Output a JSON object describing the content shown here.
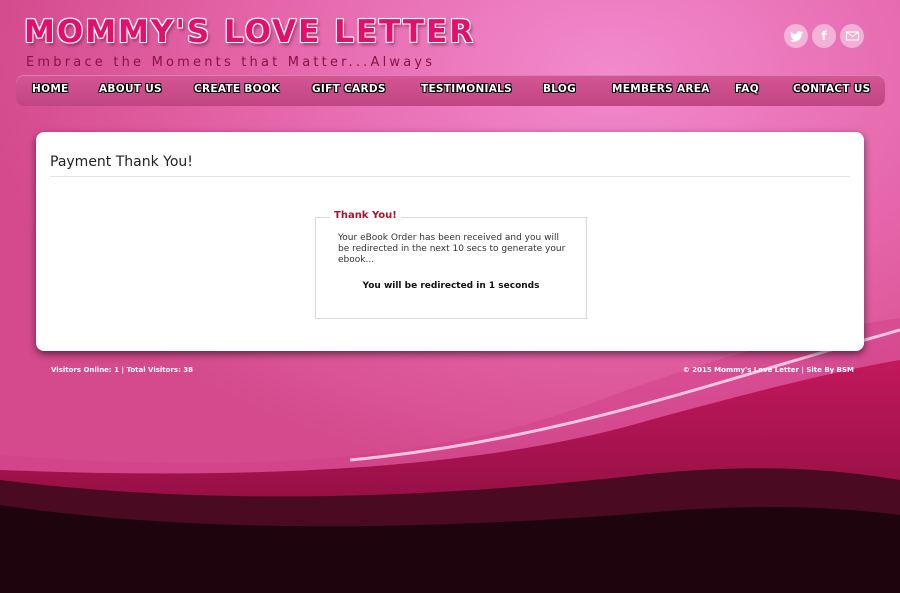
{
  "header": {
    "title": "MOMMY'S LOVE LETTER",
    "tagline": "Embrace the Moments that Matter...Always"
  },
  "social": [
    {
      "name": "twitter-icon",
      "label": "twitter"
    },
    {
      "name": "facebook-icon",
      "label": "f"
    },
    {
      "name": "email-icon",
      "label": "email"
    }
  ],
  "nav": [
    {
      "label": "HOME"
    },
    {
      "label": "ABOUT US"
    },
    {
      "label": "CREATE BOOK"
    },
    {
      "label": "GIFT CARDS"
    },
    {
      "label": "TESTIMONIALS"
    },
    {
      "label": "BLOG"
    },
    {
      "label": "MEMBERS AREA"
    },
    {
      "label": "FAQ"
    },
    {
      "label": "CONTACT US"
    }
  ],
  "content": {
    "page_title": "Payment Thank You!",
    "legend": "Thank You!",
    "message": "Your eBook Order has been received and you will be redirected in the next 10 secs to generate your ebook...",
    "redirect": "You will be redirected in 1 seconds"
  },
  "footer": {
    "visitors": "Visitors Online: 1 | Total Visitors: 38",
    "copyright": "© 2015 Mommy's Love Letter | Site By BSM"
  },
  "colors": {
    "background": "#e15fa0",
    "accent": "#e0106c",
    "legend": "#a4152e",
    "nav": "#c14583"
  }
}
